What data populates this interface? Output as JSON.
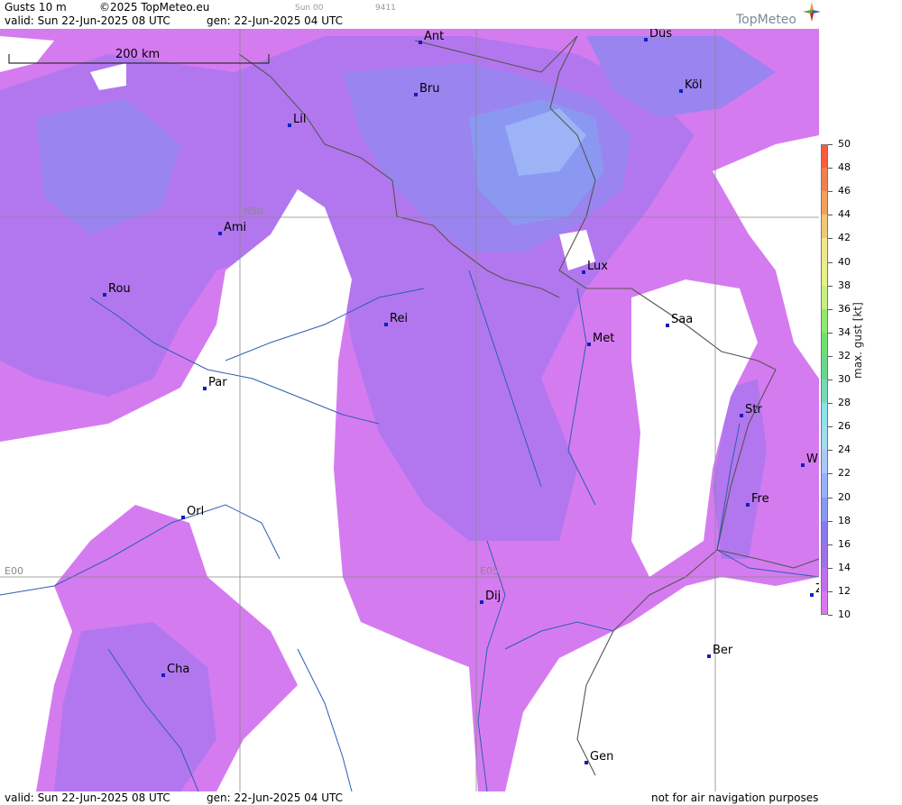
{
  "header": {
    "title": "Gusts 10 m",
    "copyright": "©2025 TopMeteo.eu",
    "run_small": "Sun 00",
    "code_small": "9411",
    "valid": "valid:  Sun  22-Jun-2025  08 UTC",
    "gen": "gen: 22-Jun-2025 04 UTC",
    "logo": "TopMeteo"
  },
  "scale_bar": {
    "label": "200 km"
  },
  "grid_labels": {
    "lat": "N50",
    "lon0": "E00",
    "lon1": "E05"
  },
  "cities": [
    {
      "name": "Ant"
    },
    {
      "name": "Düs"
    },
    {
      "name": "Köl"
    },
    {
      "name": "Bru"
    },
    {
      "name": "Lil"
    },
    {
      "name": "Ami"
    },
    {
      "name": "Rou"
    },
    {
      "name": "Lux"
    },
    {
      "name": "Rei"
    },
    {
      "name": "Saa"
    },
    {
      "name": "Met"
    },
    {
      "name": "Par"
    },
    {
      "name": "Str"
    },
    {
      "name": "W"
    },
    {
      "name": "Fre"
    },
    {
      "name": "Orl"
    },
    {
      "name": "Dij"
    },
    {
      "name": "Z"
    },
    {
      "name": "Ber"
    },
    {
      "name": "Cha"
    },
    {
      "name": "Gen"
    }
  ],
  "legend": {
    "title": "max. gust [kt]",
    "ticks": [
      50,
      48,
      46,
      44,
      42,
      40,
      38,
      36,
      34,
      32,
      30,
      28,
      26,
      24,
      22,
      20,
      18,
      16,
      14,
      12,
      10
    ],
    "colors": [
      "#ff5a3c",
      "#f08050",
      "#f0a060",
      "#f0c878",
      "#f0e890",
      "#e8f088",
      "#c8f080",
      "#90e870",
      "#70e070",
      "#68d890",
      "#78d8b8",
      "#90e0e8",
      "#a0dcf0",
      "#a8c8f8",
      "#98b0f8",
      "#8898f0",
      "#8c78f0",
      "#a070e8",
      "#c070ec",
      "#d878f0"
    ]
  },
  "footer": {
    "valid": "valid:  Sun  22-Jun-2025  08 UTC",
    "gen": "gen: 22-Jun-2025 04 UTC",
    "note": "not for air navigation purposes"
  }
}
